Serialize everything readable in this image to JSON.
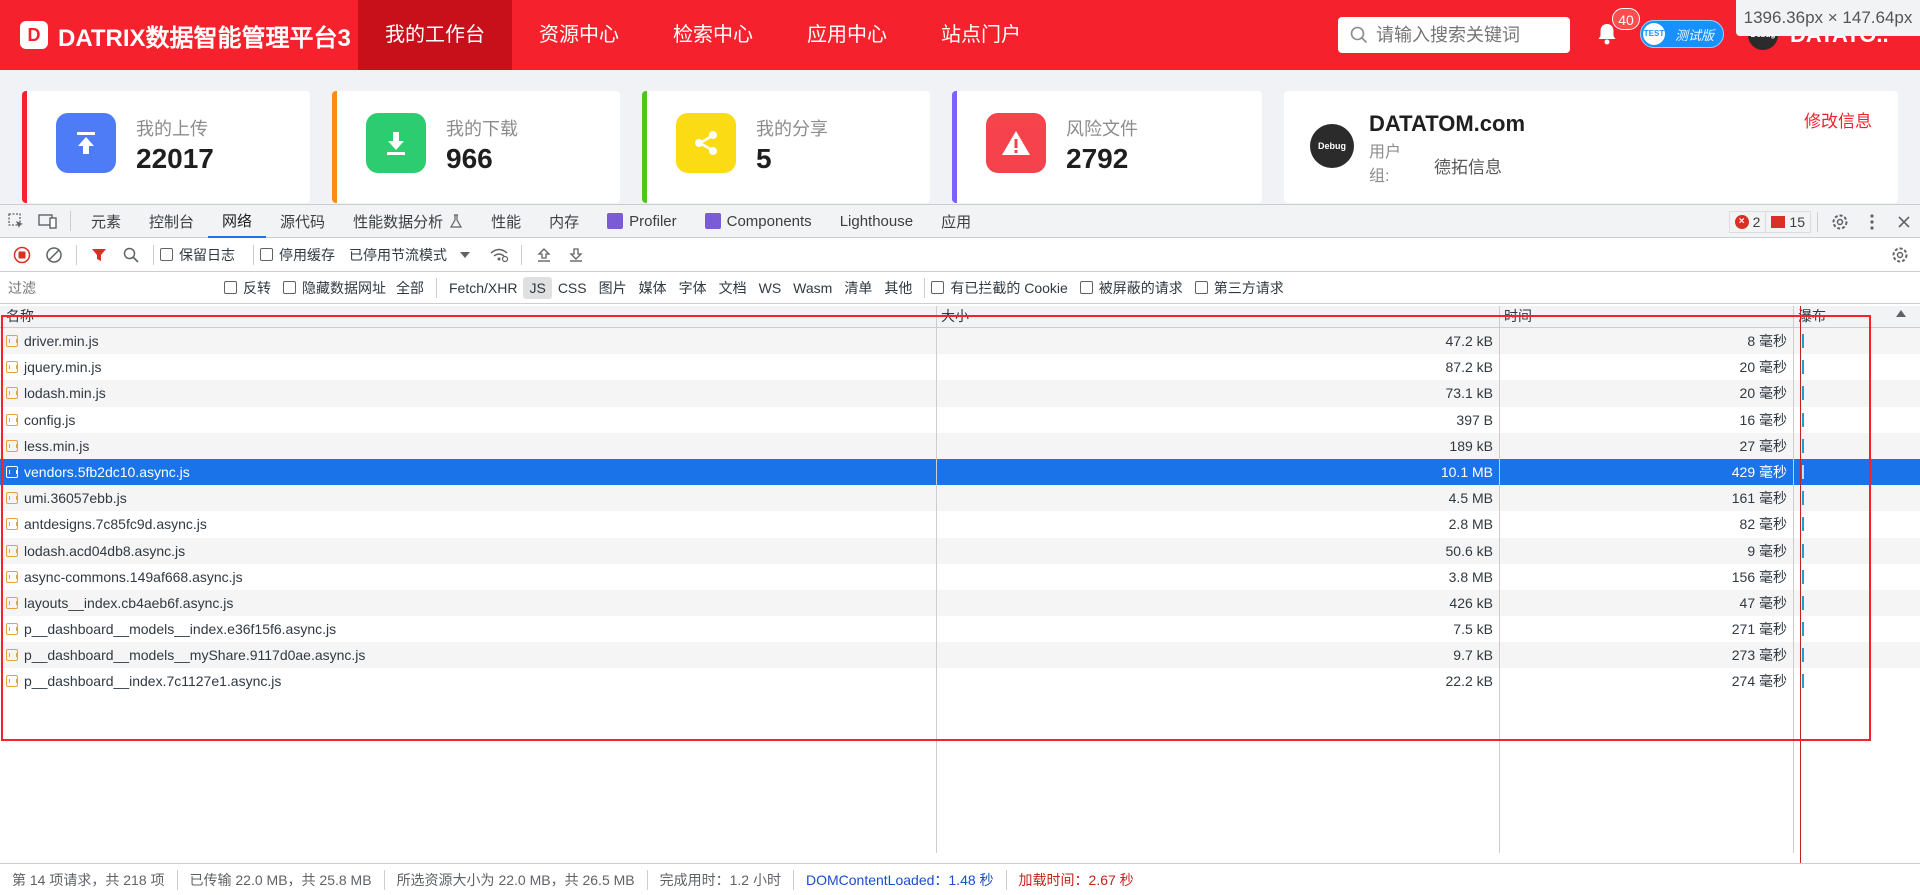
{
  "app": {
    "logo_letter": "D",
    "title": "DATRIX数据智能管理平台3",
    "nav": [
      "我的工作台",
      "资源中心",
      "检索中心",
      "应用中心",
      "站点门户"
    ],
    "search_placeholder": "请输入搜索关键词",
    "notification_count": "40",
    "test_badge_icon": "TEST",
    "test_badge_label": "测试版",
    "avatar_text": "Debug",
    "user_name": "DATATO...",
    "dimension_tooltip": "1396.36px × 147.64px",
    "colors": {
      "header_red": "#f5222d",
      "active_nav": "#c8101b"
    }
  },
  "stats": [
    {
      "label": "我的上传",
      "value": "22017",
      "icon": "upload-icon",
      "color": "#4e7cf6",
      "bar": "#f5222d"
    },
    {
      "label": "我的下载",
      "value": "966",
      "icon": "download-icon",
      "color": "#2ecc71",
      "bar": "#fa8c16"
    },
    {
      "label": "我的分享",
      "value": "5",
      "icon": "share-icon",
      "color": "#fadb14",
      "bar": "#52c41a"
    },
    {
      "label": "风险文件",
      "value": "2792",
      "icon": "warning-icon",
      "color": "#f5222d",
      "bar": "#7b61ff"
    }
  ],
  "profile": {
    "avatar_text": "Debug",
    "name": "DATATOM.com",
    "group_label": "用户组:",
    "group_value": "德拓信息",
    "edit_label": "修改信息"
  },
  "devtools": {
    "tabs": [
      "元素",
      "控制台",
      "网络",
      "源代码",
      "性能数据分析",
      "性能",
      "内存",
      "Profiler",
      "Components",
      "Lighthouse",
      "应用"
    ],
    "active_tab": "网络",
    "error_count": "2",
    "message_count": "15",
    "toolbar": {
      "preserve_log": "保留日志",
      "disable_cache": "停用缓存",
      "throttle": "已停用节流模式"
    },
    "filter": {
      "placeholder": "过滤",
      "invert": "反转",
      "hide_data_urls": "隐藏数据网址",
      "types": [
        "全部",
        "Fetch/XHR",
        "JS",
        "CSS",
        "图片",
        "媒体",
        "字体",
        "文档",
        "WS",
        "Wasm",
        "清单",
        "其他"
      ],
      "active_type": "JS",
      "blocked_cookies": "有已拦截的 Cookie",
      "blocked_requests": "被屏蔽的请求",
      "third_party": "第三方请求"
    },
    "columns": {
      "name": "名称",
      "size": "大小",
      "time": "时间",
      "waterfall": "瀑布"
    },
    "rows": [
      {
        "name": "driver.min.js",
        "size": "47.2 kB",
        "time": "8 毫秒"
      },
      {
        "name": "jquery.min.js",
        "size": "87.2 kB",
        "time": "20 毫秒"
      },
      {
        "name": "lodash.min.js",
        "size": "73.1 kB",
        "time": "20 毫秒"
      },
      {
        "name": "config.js",
        "size": "397 B",
        "time": "16 毫秒"
      },
      {
        "name": "less.min.js",
        "size": "189 kB",
        "time": "27 毫秒"
      },
      {
        "name": "vendors.5fb2dc10.async.js",
        "size": "10.1 MB",
        "time": "429 毫秒",
        "selected": true
      },
      {
        "name": "umi.36057ebb.js",
        "size": "4.5 MB",
        "time": "161 毫秒"
      },
      {
        "name": "antdesigns.7c85fc9d.async.js",
        "size": "2.8 MB",
        "time": "82 毫秒"
      },
      {
        "name": "lodash.acd04db8.async.js",
        "size": "50.6 kB",
        "time": "9 毫秒"
      },
      {
        "name": "async-commons.149af668.async.js",
        "size": "3.8 MB",
        "time": "156 毫秒"
      },
      {
        "name": "layouts__index.cb4aeb6f.async.js",
        "size": "426 kB",
        "time": "47 毫秒"
      },
      {
        "name": "p__dashboard__models__index.e36f15f6.async.js",
        "size": "7.5 kB",
        "time": "271 毫秒"
      },
      {
        "name": "p__dashboard__models__myShare.9117d0ae.async.js",
        "size": "9.7 kB",
        "time": "273 毫秒"
      },
      {
        "name": "p__dashboard__index.7c1127e1.async.js",
        "size": "22.2 kB",
        "time": "274 毫秒"
      }
    ],
    "status": {
      "requests": "第 14 项请求，共 218 项",
      "transferred": "已传输 22.0 MB，共 25.8 MB",
      "resources": "所选资源大小为 22.0 MB，共 26.5 MB",
      "finish": "完成用时：1.2 小时",
      "dcl": "DOMContentLoaded：1.48 秒",
      "load": "加载时间：2.67 秒"
    }
  }
}
